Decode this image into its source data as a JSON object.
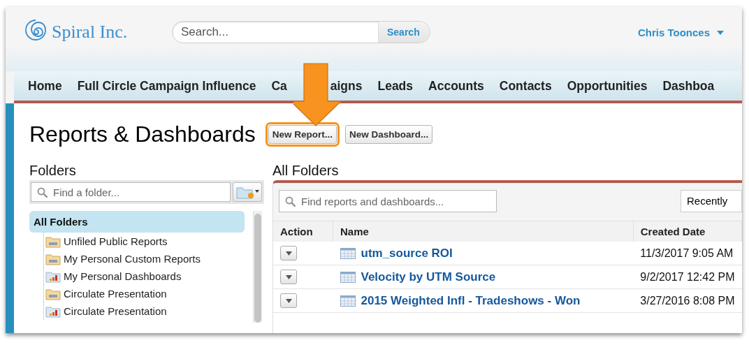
{
  "header": {
    "logo_text": "Spiral Inc.",
    "search": {
      "placeholder": "Search...",
      "button": "Search"
    },
    "user_menu": "Chris Toonces"
  },
  "nav_tabs": [
    {
      "label": "Home",
      "selected": false
    },
    {
      "label": "Full Circle Campaign Influence",
      "selected": false
    },
    {
      "label_parts": [
        "Ca",
        "aigns"
      ],
      "selected": false
    },
    {
      "label": "Leads",
      "selected": false
    },
    {
      "label": "Accounts",
      "selected": false
    },
    {
      "label": "Contacts",
      "selected": false
    },
    {
      "label": "Opportunities",
      "selected": false
    },
    {
      "label": "Dashboa",
      "selected": false
    }
  ],
  "page_title": "Reports & Dashboards",
  "buttons": [
    {
      "label": "New Report...",
      "highlighted": true
    },
    {
      "label": "New Dashboard...",
      "highlighted": false
    }
  ],
  "folders": {
    "title": "Folders",
    "search_placeholder": "Find a folder...",
    "items": [
      {
        "label": "All Folders",
        "selected": true,
        "children": [
          {
            "label": "Unfiled Public Reports",
            "kind": "reports",
            "selected": false
          },
          {
            "label": "My Personal Custom Reports",
            "kind": "reports",
            "selected": false
          },
          {
            "label": "My Personal Dashboards",
            "kind": "dashboards",
            "selected": false
          },
          {
            "label": "Circulate Presentation",
            "kind": "reports",
            "selected": false
          },
          {
            "label": "Circulate Presentation",
            "kind": "dashboards",
            "selected": false
          }
        ]
      }
    ]
  },
  "content": {
    "title": "All Folders",
    "search_placeholder": "Find reports and dashboards...",
    "sort_select": "Recently",
    "table": {
      "columns": [
        "Action",
        "Name",
        "Created Date"
      ],
      "rows": [
        {
          "name": "utm_source ROI",
          "created": "11/3/2017 9:05 AM"
        },
        {
          "name": "Velocity by UTM Source",
          "created": "9/2/2017 12:42 PM"
        },
        {
          "name": "2015 Weighted Infl - Tradeshows - Won",
          "created": "3/27/2016 8:08 PM"
        }
      ]
    }
  }
}
